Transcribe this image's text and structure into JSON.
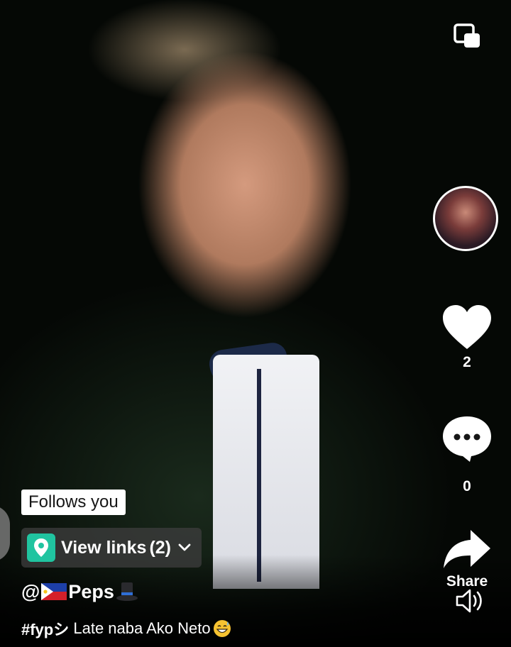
{
  "video": {
    "follows_badge": "Follows you",
    "links_label": "View links",
    "links_count": "(2)",
    "username_prefix": "@",
    "username": "Peps",
    "caption_tag": "#fypシ",
    "caption_text": " Late naba Ako Neto"
  },
  "actions": {
    "like_count": "2",
    "comment_count": "0",
    "share_label": "Share"
  },
  "icons": {
    "pip": "picture-in-picture-icon",
    "like": "heart-icon",
    "comment": "comment-bubble-icon",
    "share": "share-arrow-icon",
    "sound": "speaker-icon",
    "location": "location-pin-icon",
    "chevron": "chevron-down-icon"
  },
  "colors": {
    "link_pin_bg": "#20c4a0",
    "text": "#ffffff"
  }
}
